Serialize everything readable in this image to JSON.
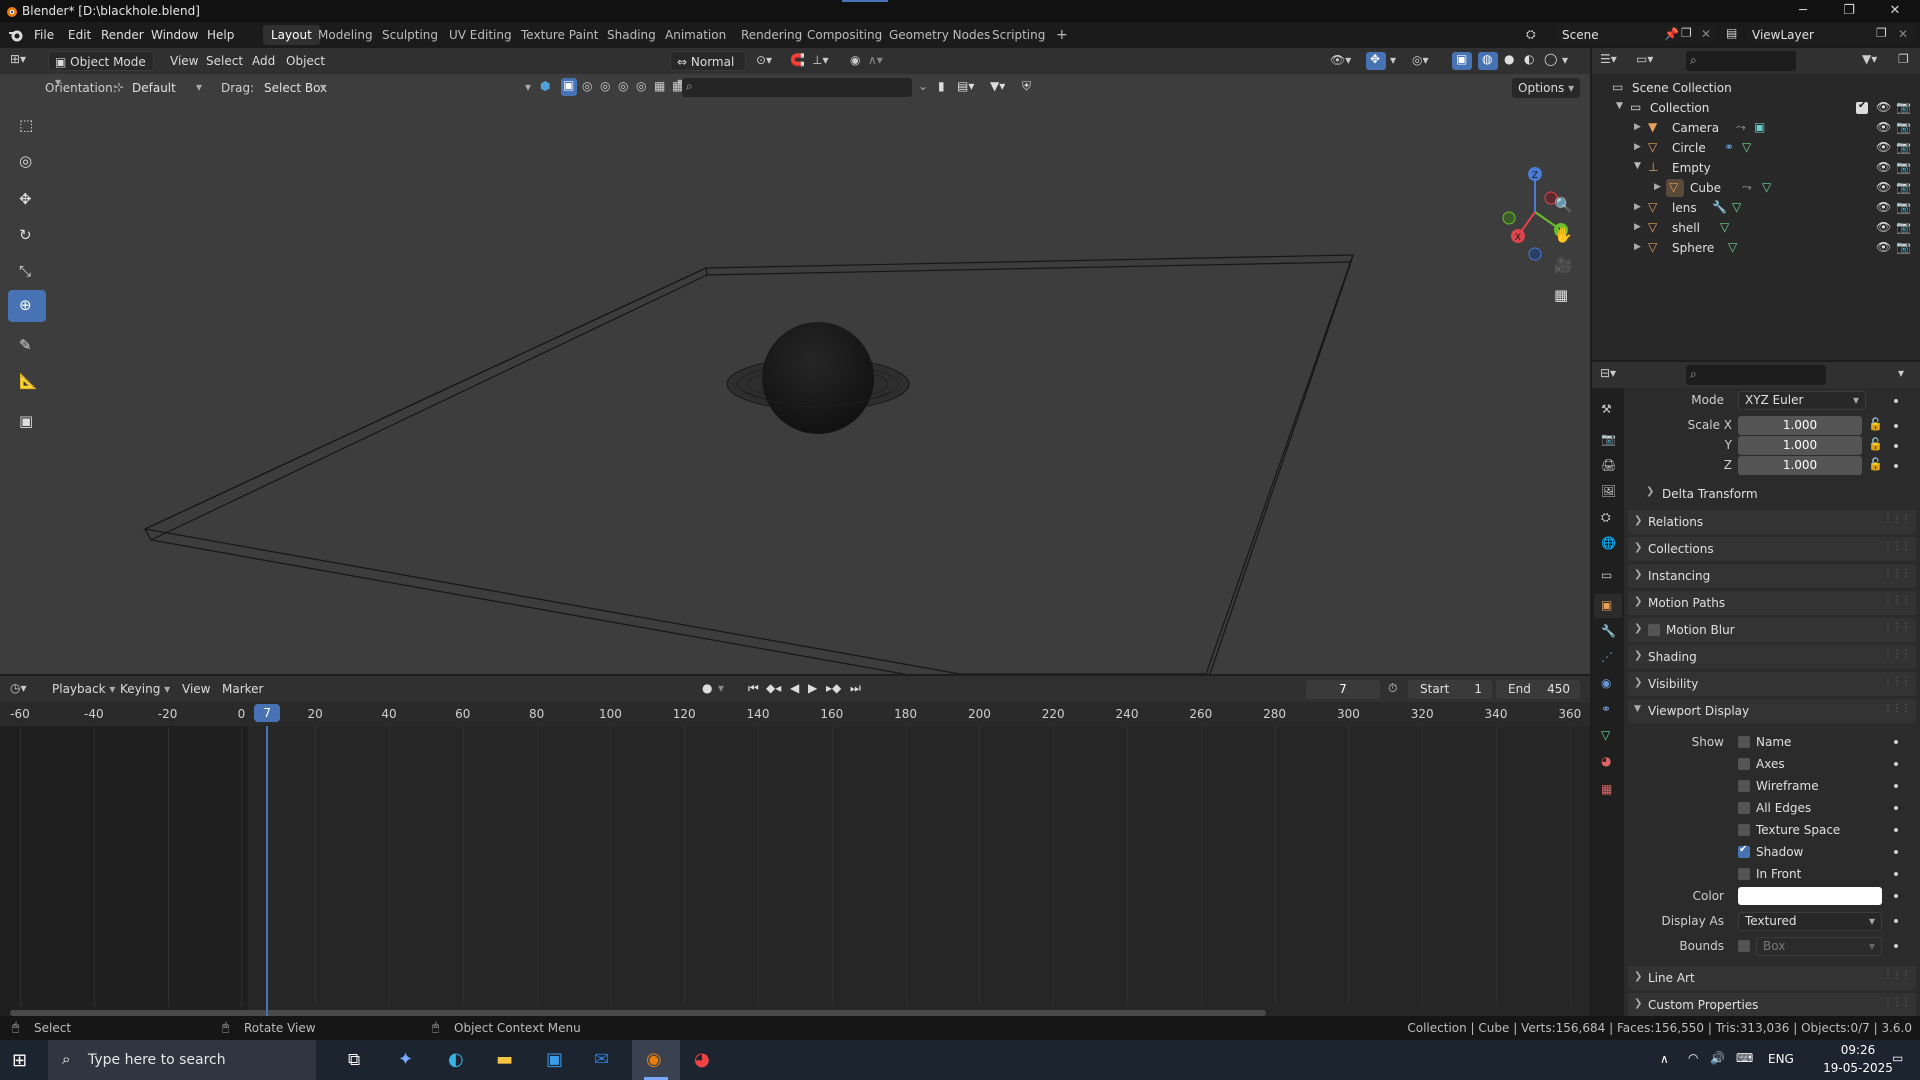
{
  "window": {
    "title": "Blender* [D:\\blackhole.blend]",
    "controls": [
      "minimize",
      "restore",
      "close"
    ]
  },
  "menubar": {
    "menus": [
      "File",
      "Edit",
      "Render",
      "Window",
      "Help"
    ],
    "workspaces": [
      "Layout",
      "Modeling",
      "Sculpting",
      "UV Editing",
      "Texture Paint",
      "Shading",
      "Animation",
      "Rendering",
      "Compositing",
      "Geometry Nodes",
      "Scripting"
    ],
    "active_workspace": "Layout",
    "add_workspace": "+",
    "scene": "Scene",
    "view_layer": "ViewLayer"
  },
  "viewport_header": {
    "mode": "Object Mode",
    "menus": [
      "View",
      "Select",
      "Add",
      "Object"
    ],
    "transform_orientation": "Normal",
    "orientation_label": "Orientation:",
    "orientation_value": "Default",
    "drag_label": "Drag:",
    "drag_value": "Select Box",
    "options": "Options"
  },
  "outliner": {
    "root": "Scene Collection",
    "collection": "Collection",
    "items": [
      {
        "name": "Camera",
        "indent": 1
      },
      {
        "name": "Circle",
        "indent": 1
      },
      {
        "name": "Empty",
        "indent": 1
      },
      {
        "name": "Cube",
        "indent": 2
      },
      {
        "name": "lens",
        "indent": 1
      },
      {
        "name": "shell",
        "indent": 1
      },
      {
        "name": "Sphere",
        "indent": 1
      }
    ]
  },
  "properties": {
    "mode_label": "Mode",
    "mode_value": "XYZ Euler",
    "scale": {
      "x_label": "Scale X",
      "y_label": "Y",
      "z_label": "Z",
      "x": "1.000",
      "y": "1.000",
      "z": "1.000"
    },
    "delta_transform": "Delta Transform",
    "panels": [
      "Relations",
      "Collections",
      "Instancing",
      "Motion Paths",
      "Motion Blur",
      "Shading",
      "Visibility",
      "Viewport Display"
    ],
    "viewport_display": {
      "show_label": "Show",
      "options": [
        {
          "label": "Name",
          "checked": false
        },
        {
          "label": "Axes",
          "checked": false
        },
        {
          "label": "Wireframe",
          "checked": false
        },
        {
          "label": "All Edges",
          "checked": false
        },
        {
          "label": "Texture Space",
          "checked": false
        },
        {
          "label": "Shadow",
          "checked": true
        },
        {
          "label": "In Front",
          "checked": false
        }
      ],
      "color_label": "Color",
      "color_value": "#ffffff",
      "display_as_label": "Display As",
      "display_as_value": "Textured",
      "bounds_label": "Bounds",
      "bounds_value": "Box"
    },
    "bottom_panels": [
      "Line Art",
      "Custom Properties"
    ]
  },
  "timeline": {
    "menus": [
      "Playback",
      "Keying",
      "View",
      "Marker"
    ],
    "current_frame": "7",
    "start_label": "Start",
    "start": "1",
    "end_label": "End",
    "end": "450",
    "ticks": [
      "-60",
      "-40",
      "-20",
      "0",
      "20",
      "40",
      "60",
      "80",
      "100",
      "120",
      "140",
      "160",
      "180",
      "200",
      "220",
      "240",
      "260",
      "280",
      "300",
      "320",
      "340",
      "360"
    ],
    "playhead": "7"
  },
  "statusbar": {
    "hints": [
      "Select",
      "Rotate View",
      "Object Context Menu"
    ],
    "stats": "Collection | Cube | Verts:156,684 | Faces:156,550 | Tris:313,036 | Objects:0/7 | 3.6.0"
  },
  "taskbar": {
    "search_placeholder": "Type here to search",
    "language": "ENG",
    "time": "09:26",
    "date": "19-05-2025"
  },
  "colors": {
    "accent": "#4772b3",
    "viewport_bg": "#3d3d3d",
    "playhead": "#4772b3"
  }
}
